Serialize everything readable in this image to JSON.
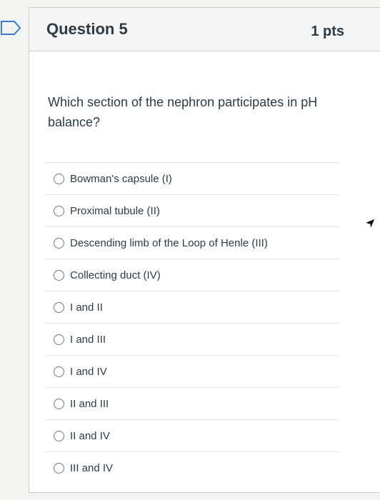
{
  "question": {
    "title": "Question 5",
    "points": "1 pts",
    "text": "Which section of the nephron participates in pH balance?"
  },
  "answers": [
    {
      "label": "Bowman's capsule (I)"
    },
    {
      "label": "Proximal tubule (II)"
    },
    {
      "label": "Descending limb of the Loop of Henle (III)"
    },
    {
      "label": "Collecting duct (IV)"
    },
    {
      "label": "I and II"
    },
    {
      "label": "I and III"
    },
    {
      "label": "I and IV"
    },
    {
      "label": "II and III"
    },
    {
      "label": "II and IV"
    },
    {
      "label": "III and IV"
    }
  ],
  "icons": {
    "bookmark": "bookmark-icon",
    "radio": "radio-icon",
    "cursor": "cursor-icon"
  },
  "colors": {
    "text": "#2d3b45",
    "border": "#c7cdd1",
    "bookmark": "#3a7bd5"
  }
}
